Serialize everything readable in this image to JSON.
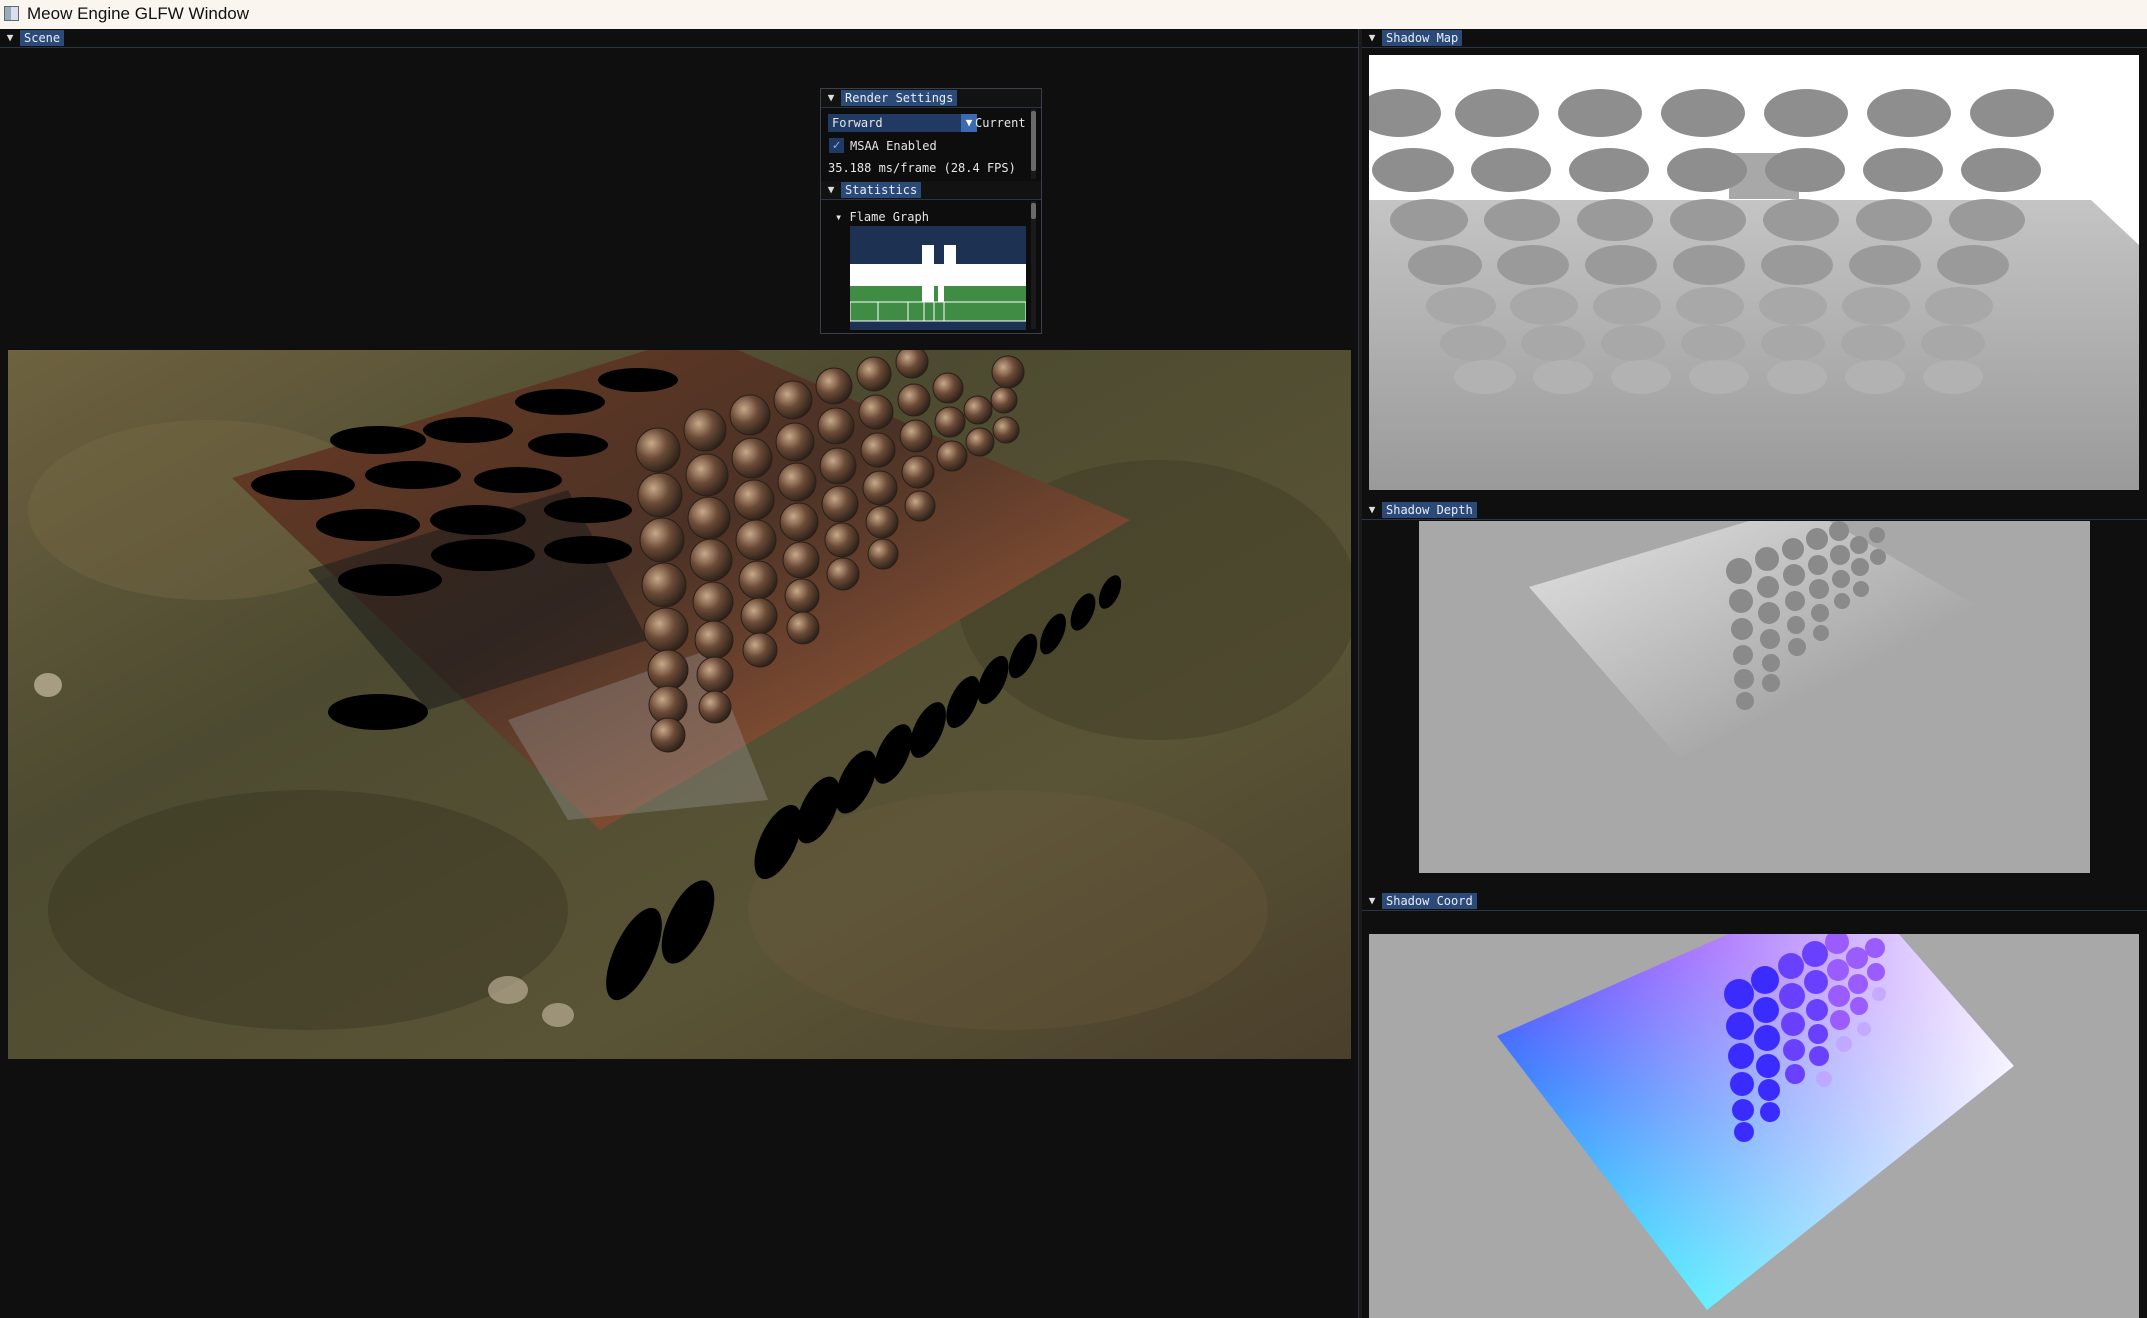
{
  "window": {
    "title": "Meow Engine GLFW Window",
    "icon": "app-window-icon"
  },
  "panels": {
    "scene": {
      "title": "Scene"
    },
    "shadow_map": {
      "title": "Shadow Map"
    },
    "shadow_depth": {
      "title": "Shadow Depth"
    },
    "shadow_coord": {
      "title": "Shadow Coord"
    }
  },
  "render_settings": {
    "title": "Render Settings",
    "mode_selected": "Forward",
    "mode_label": "Current",
    "msaa_label": "MSAA Enabled",
    "msaa_checked": true,
    "frame_time": "35.188 ms/frame (28.4 FPS)"
  },
  "statistics": {
    "title": "Statistics",
    "flame_graph_label": "Flame Graph"
  },
  "colors": {
    "header_blue": "#2c4a78",
    "combo_bg": "#203a63",
    "flame_bg": "#1d3152",
    "flame_green": "#3f8c45",
    "panel_bg": "#0f0f0f"
  }
}
